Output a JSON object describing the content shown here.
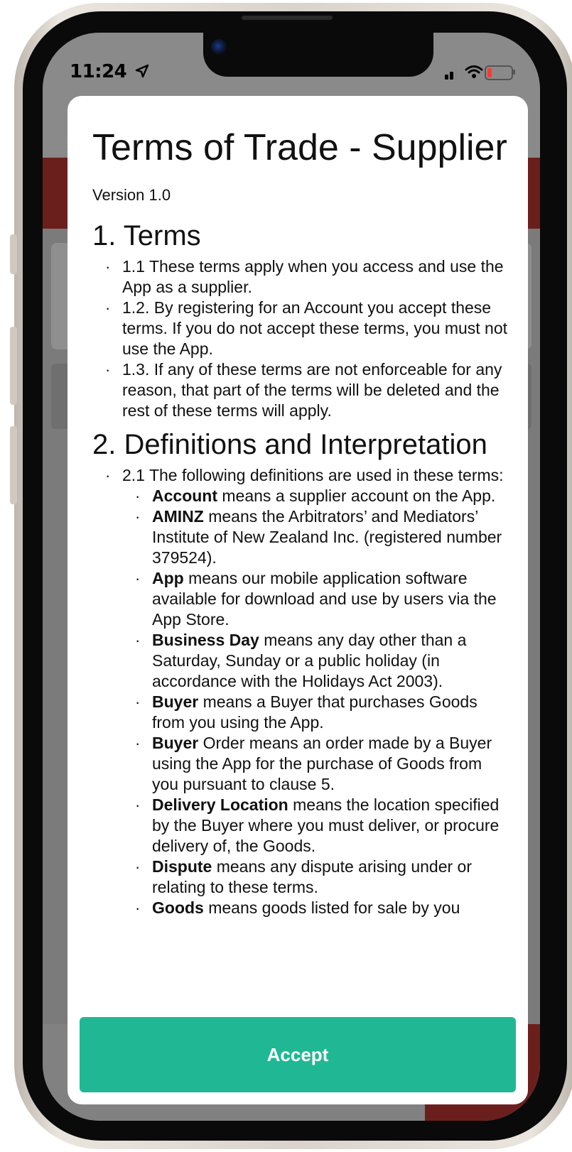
{
  "status_bar": {
    "time": "11:24",
    "location_icon": "location-arrow-icon",
    "signal_icon": "cellular-signal-icon",
    "wifi_icon": "wifi-icon",
    "battery_icon": "battery-icon",
    "battery_color": "#ff3b30"
  },
  "modal": {
    "title": "Terms of Trade - Supplier",
    "version": "Version 1.0",
    "section1": {
      "heading": "1. Terms",
      "items": [
        "1.1 These terms apply when you access and use the App as a supplier.",
        "1.2. By registering for an Account you accept these terms.  If you do not accept these terms, you must not use the App.",
        "1.3. If any of these terms are not enforceable for any reason, that part of the terms will be deleted and the rest of these terms will apply."
      ]
    },
    "section2": {
      "heading": "2. Definitions and Interpretation",
      "intro": "2.1 The following definitions are used in these terms:",
      "definitions": [
        {
          "term": "Account",
          "text": " means a supplier account on the App."
        },
        {
          "term": "AMINZ",
          "text": " means the Arbitrators’ and Mediators’ Institute of New Zealand Inc. (registered number 379524)."
        },
        {
          "term": "App",
          "text": " means our mobile application software available for download and use by users via the App Store."
        },
        {
          "term": "Business Day",
          "text": " means any day other than a Saturday, Sunday or a public holiday (in accordance with the Holidays Act 2003)."
        },
        {
          "term": "Buyer",
          "text": " means a Buyer that purchases Goods from you using the App."
        },
        {
          "term": "Buyer",
          "text": " Order means an order made by a Buyer using the App for the purchase of Goods from you pursuant to clause 5."
        },
        {
          "term": "Delivery Location",
          "text": " means the location specified by the Buyer where you must deliver, or procure delivery of, the Goods."
        },
        {
          "term": "Dispute",
          "text": " means any dispute arising under or relating to these terms."
        },
        {
          "term": "Goods",
          "text": " means goods listed for sale by you"
        }
      ]
    },
    "accept_label": "Accept",
    "accept_color": "#20b894"
  }
}
